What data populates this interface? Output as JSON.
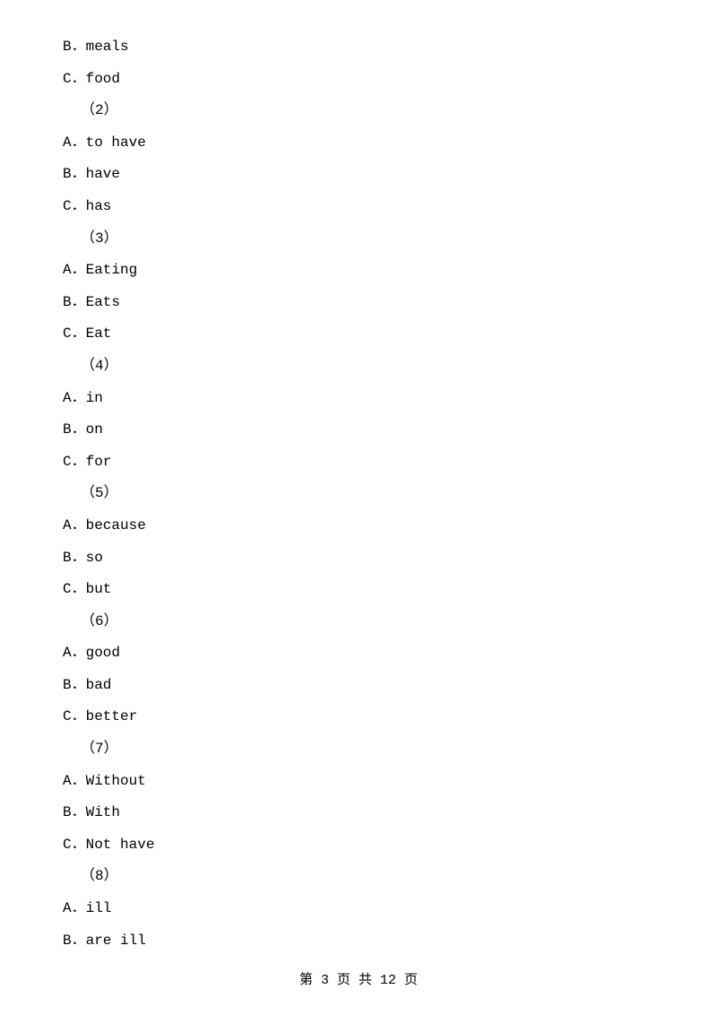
{
  "content": {
    "items": [
      {
        "id": "b-meals",
        "text": "B．meals"
      },
      {
        "id": "c-food",
        "text": "C．food"
      },
      {
        "id": "label-2",
        "text": "（2）"
      },
      {
        "id": "a-to-have",
        "text": "A．to have"
      },
      {
        "id": "b-have",
        "text": "B．have"
      },
      {
        "id": "c-has",
        "text": "C．has"
      },
      {
        "id": "label-3",
        "text": "（3）"
      },
      {
        "id": "a-eating",
        "text": "A．Eating"
      },
      {
        "id": "b-eats",
        "text": "B．Eats"
      },
      {
        "id": "c-eat",
        "text": "C．Eat"
      },
      {
        "id": "label-4",
        "text": "（4）"
      },
      {
        "id": "a-in",
        "text": "A．in"
      },
      {
        "id": "b-on",
        "text": "B．on"
      },
      {
        "id": "c-for",
        "text": "C．for"
      },
      {
        "id": "label-5",
        "text": "（5）"
      },
      {
        "id": "a-because",
        "text": "A．because"
      },
      {
        "id": "b-so",
        "text": "B．so"
      },
      {
        "id": "c-but",
        "text": "C．but"
      },
      {
        "id": "label-6",
        "text": "（6）"
      },
      {
        "id": "a-good",
        "text": "A．good"
      },
      {
        "id": "b-bad",
        "text": "B．bad"
      },
      {
        "id": "c-better",
        "text": "C．better"
      },
      {
        "id": "label-7",
        "text": "（7）"
      },
      {
        "id": "a-without",
        "text": "A．Without"
      },
      {
        "id": "b-with",
        "text": "B．With"
      },
      {
        "id": "c-not-have",
        "text": "C．Not have"
      },
      {
        "id": "label-8",
        "text": "（8）"
      },
      {
        "id": "a-ill",
        "text": "A．ill"
      },
      {
        "id": "b-are-ill",
        "text": "B．are ill"
      }
    ],
    "footer": {
      "text": "第 3 页 共 12 页"
    }
  }
}
